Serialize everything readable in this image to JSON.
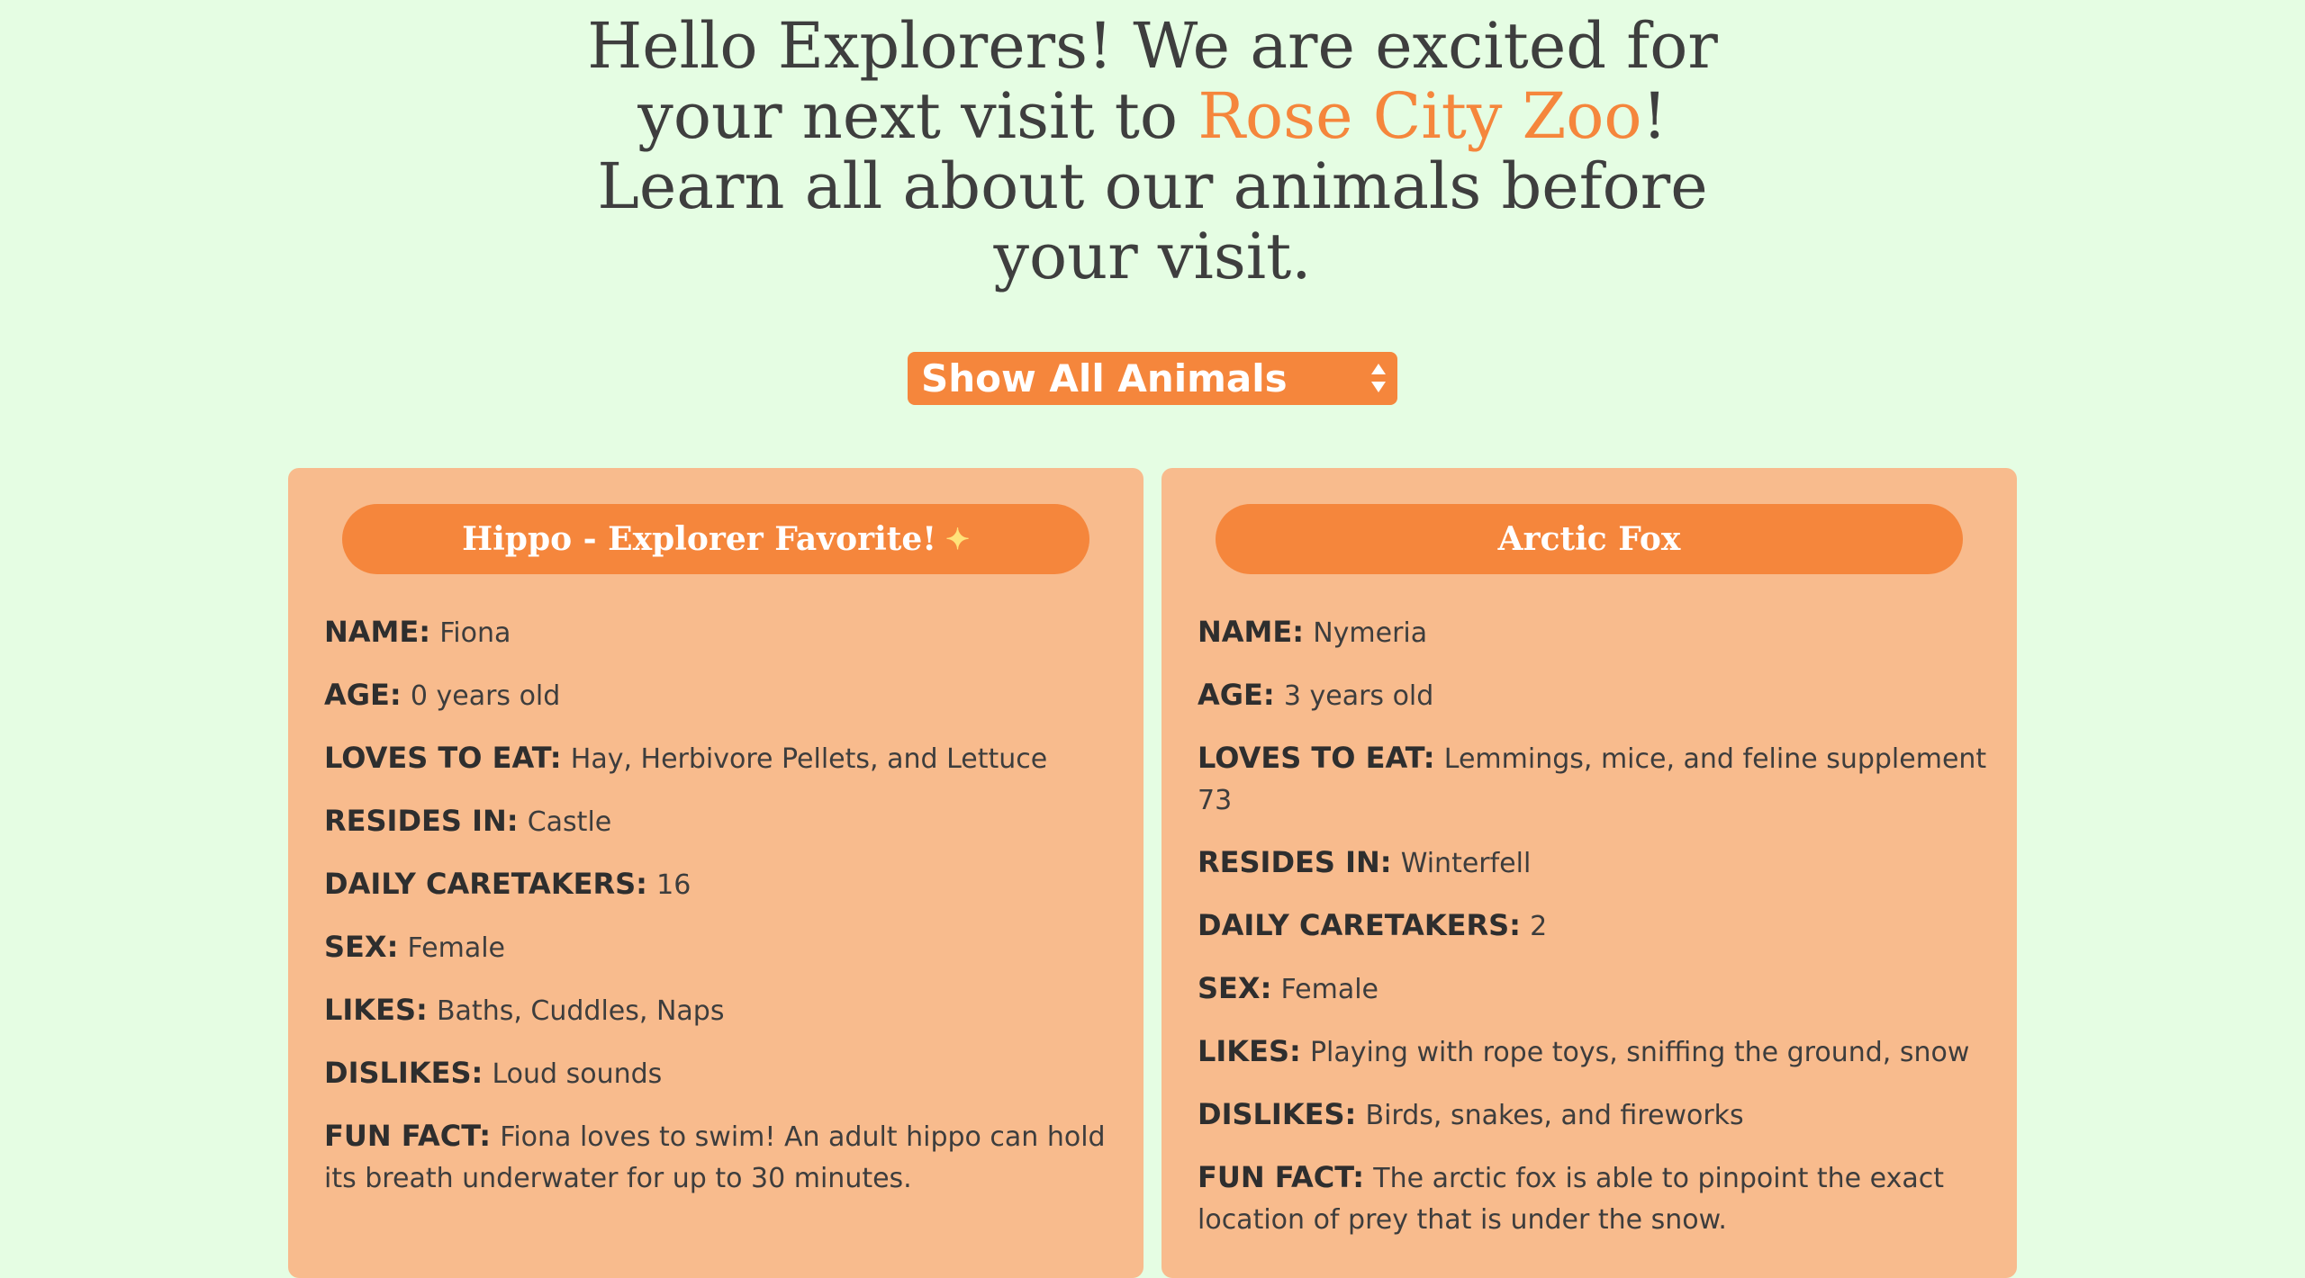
{
  "header": {
    "line1": "Hello Explorers! We are excited for",
    "line2_before": "your next visit to ",
    "zoo_name": "Rose City Zoo",
    "line2_after": "!",
    "line3": "Learn all about our animals before",
    "line4": "your visit."
  },
  "filter": {
    "selected": "Show All Animals",
    "icon": "up-down-arrows-icon"
  },
  "colors": {
    "background": "#e5fde3",
    "accent": "#f5863c",
    "card": "#f8bb8d",
    "text": "#3d3d3d"
  },
  "animals": [
    {
      "title": "Hippo - Explorer Favorite!",
      "badge_icon": "sparkle-star-icon",
      "facts": [
        {
          "label": "NAME:",
          "value": "Fiona"
        },
        {
          "label": "AGE:",
          "value": "0 years old"
        },
        {
          "label": "LOVES TO EAT:",
          "value": "Hay, Herbivore Pellets, and Lettuce"
        },
        {
          "label": "RESIDES IN:",
          "value": "Castle"
        },
        {
          "label": "DAILY CARETAKERS:",
          "value": "16"
        },
        {
          "label": "SEX:",
          "value": "Female"
        },
        {
          "label": "LIKES:",
          "value": "Baths, Cuddles, Naps"
        },
        {
          "label": "DISLIKES:",
          "value": "Loud sounds"
        },
        {
          "label": "FUN FACT:",
          "value": "Fiona loves to swim! An adult hippo can hold its breath underwater for up to 30 minutes."
        }
      ]
    },
    {
      "title": "Arctic Fox",
      "badge_icon": "",
      "facts": [
        {
          "label": "NAME:",
          "value": "Nymeria"
        },
        {
          "label": "AGE:",
          "value": "3 years old"
        },
        {
          "label": "LOVES TO EAT:",
          "value": "Lemmings, mice, and feline supplement 73"
        },
        {
          "label": "RESIDES IN:",
          "value": "Winterfell"
        },
        {
          "label": "DAILY CARETAKERS:",
          "value": "2"
        },
        {
          "label": "SEX:",
          "value": "Female"
        },
        {
          "label": "LIKES:",
          "value": "Playing with rope toys, sniffing the ground, snow"
        },
        {
          "label": "DISLIKES:",
          "value": "Birds, snakes, and fireworks"
        },
        {
          "label": "FUN FACT:",
          "value": "The arctic fox is able to pinpoint the exact location of prey that is under the snow."
        }
      ]
    }
  ]
}
